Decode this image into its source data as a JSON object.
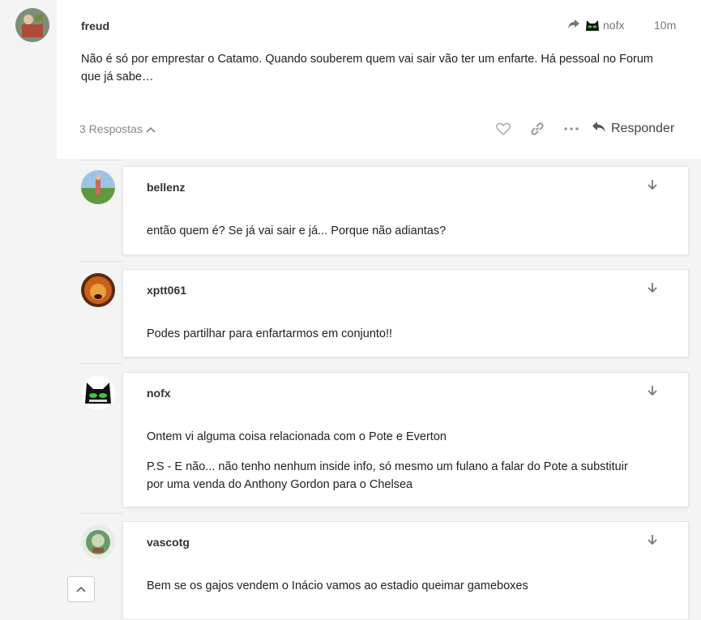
{
  "main_post": {
    "author": "freud",
    "reply_to_user": "nofx",
    "time": "10m",
    "text_line1": "Não é só por emprestar o Catamo. Quando souberem quem vai sair vão ter um enfarte. Há pessoal no Forum",
    "text_line2": "que já sabe…",
    "replies_label": "3 Respostas",
    "reply_label": "Responder"
  },
  "replies": [
    {
      "author": "bellenz",
      "text": "então quem é? Se já vai sair e já... Porque não adiantas?"
    },
    {
      "author": "xptt061",
      "text": "Podes partilhar para enfartarmos em conjunto!!"
    },
    {
      "author": "nofx",
      "text1": "Ontem vi alguma coisa relacionada com o Pote e Everton",
      "text2_line1": "P.S - E não... não tenho nenhum inside info, só mesmo um fulano a falar do Pote a substituir",
      "text2_line2": "por uma venda do Anthony Gordon para o Chelsea"
    },
    {
      "author": "vascotg",
      "text": "Bem se os gajos vendem o Inácio vamos ao estadio queimar gameboxes"
    }
  ],
  "icons": {
    "share": "share-arrow-icon",
    "heart": "heart-icon",
    "link": "link-icon",
    "more": "ellipsis-icon",
    "reply": "reply-arrow-icon",
    "expand": "chevron-up-icon",
    "down": "arrow-down-icon",
    "scroll_top": "chevron-up-icon"
  }
}
